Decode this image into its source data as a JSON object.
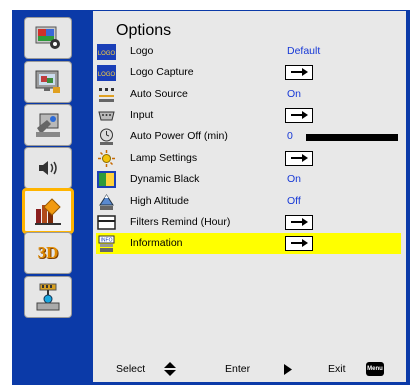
{
  "window": {
    "title": "Options"
  },
  "sidebar": {
    "items": [
      {
        "name": "picture",
        "icon": "picture-settings-icon",
        "label": ""
      },
      {
        "name": "display",
        "icon": "display-settings-icon",
        "label": ""
      },
      {
        "name": "setup",
        "icon": "setup-icon",
        "label": ""
      },
      {
        "name": "volume",
        "icon": "volume-icon",
        "label": ""
      },
      {
        "name": "options",
        "icon": "options-icon",
        "label": "",
        "active": true
      },
      {
        "name": "3d",
        "icon": "3d-icon",
        "label": "3D"
      },
      {
        "name": "lan",
        "icon": "lan-icon",
        "label": ""
      }
    ]
  },
  "menu": {
    "items": [
      {
        "label": "Logo",
        "value": "Default",
        "icon": "logo-icon",
        "control": "value"
      },
      {
        "label": "Logo Capture",
        "value": "",
        "icon": "logo-capture-icon",
        "control": "enter"
      },
      {
        "label": "Auto Source",
        "value": "On",
        "icon": "auto-source-icon",
        "control": "value"
      },
      {
        "label": "Input",
        "value": "",
        "icon": "input-icon",
        "control": "enter"
      },
      {
        "label": "Auto Power Off (min)",
        "value": "0",
        "icon": "auto-power-off-icon",
        "control": "slider",
        "level": 0
      },
      {
        "label": "Lamp Settings",
        "value": "",
        "icon": "lamp-settings-icon",
        "control": "enter"
      },
      {
        "label": "Dynamic Black",
        "value": "On",
        "icon": "dynamic-black-icon",
        "control": "value"
      },
      {
        "label": "High Altitude",
        "value": "Off",
        "icon": "high-altitude-icon",
        "control": "value"
      },
      {
        "label": "Filters Remind (Hour)",
        "value": "",
        "icon": "filter-icon",
        "control": "enter"
      },
      {
        "label": "Information",
        "value": "",
        "icon": "information-icon",
        "control": "enter",
        "selected": true
      }
    ]
  },
  "footer": {
    "select_label": "Select",
    "enter_label": "Enter",
    "exit_label": "Exit",
    "menu_key_label": "Menu"
  },
  "colors": {
    "frame": "#0b3aa8",
    "panel": "#e8e8e8",
    "highlight": "#ffff00",
    "active_border": "#ffb400",
    "value_text": "#1638d6"
  }
}
